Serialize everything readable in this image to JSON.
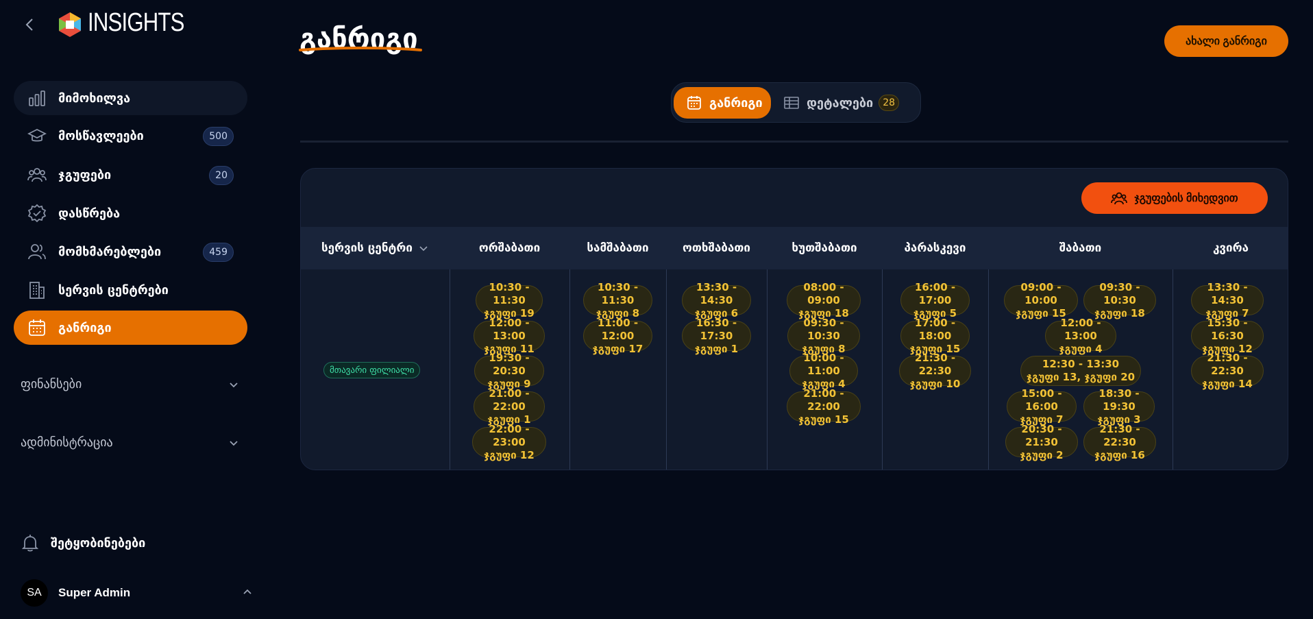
{
  "sidebar": {
    "brand": "INSIGHTS",
    "items": [
      {
        "label": "მიმოხილვა",
        "icon": "bar-chart-icon",
        "badge": ""
      },
      {
        "label": "მოსწავლეები",
        "icon": "graduation-cap-icon",
        "badge": "500"
      },
      {
        "label": "ჯგუფები",
        "icon": "groups-icon",
        "badge": "20"
      },
      {
        "label": "დასწრება",
        "icon": "check-badge-icon",
        "badge": ""
      },
      {
        "label": "მომხმარებლები",
        "icon": "users-icon",
        "badge": "459"
      },
      {
        "label": "სერვის ცენტრები",
        "icon": "building-icon",
        "badge": ""
      },
      {
        "label": "განრიგი",
        "icon": "calendar-icon",
        "badge": ""
      }
    ],
    "sections": [
      {
        "label": "ფინანსები"
      },
      {
        "label": "ადმინისტრაცია"
      }
    ],
    "notifications": "შეტყობინებები",
    "user": {
      "initials": "SA",
      "name": "Super Admin"
    }
  },
  "header": {
    "title": "განრიგი",
    "new_button": "ახალი განრიგი"
  },
  "tabs": {
    "schedule": "განრიგი",
    "details": "დეტალები",
    "details_count": "28"
  },
  "colors": {
    "accent": "#e67000",
    "background": "#050b19",
    "card": "#111a2c",
    "pill_text": "#f2c236",
    "branch_text": "#3fe0a8"
  },
  "schedule": {
    "group_button": "ჯგუფების მიხედვით",
    "center_header": "სერვის ცენტრი",
    "days": [
      "ორშაბათი",
      "სამშაბათი",
      "ოთხშაბათი",
      "ხუთშაბათი",
      "პარასკევი",
      "შაბათი",
      "კვირა"
    ],
    "branch": "მთავარი ფილიალი",
    "slots": {
      "mon": [
        {
          "time": "10:30 - 11:30",
          "group": "ჯგუფი 19"
        },
        {
          "time": "12:00 - 13:00",
          "group": "ჯგუფი 11"
        },
        {
          "time": "19:30 - 20:30",
          "group": "ჯგუფი 9"
        },
        {
          "time": "21:00 - 22:00",
          "group": "ჯგუფი 1"
        },
        {
          "time": "22:00 - 23:00",
          "group": "ჯგუფი 12"
        }
      ],
      "tue": [
        {
          "time": "10:30 - 11:30",
          "group": "ჯგუფი 8"
        },
        {
          "time": "11:00 - 12:00",
          "group": "ჯგუფი 17"
        }
      ],
      "wed": [
        {
          "time": "13:30 - 14:30",
          "group": "ჯგუფი 6"
        },
        {
          "time": "16:30 - 17:30",
          "group": "ჯგუფი 1"
        }
      ],
      "thu": [
        {
          "time": "08:00 - 09:00",
          "group": "ჯგუფი 18"
        },
        {
          "time": "09:30 - 10:30",
          "group": "ჯგუფი 8"
        },
        {
          "time": "10:00 - 11:00",
          "group": "ჯგუფი 4"
        },
        {
          "time": "21:00 - 22:00",
          "group": "ჯგუფი 15"
        }
      ],
      "fri": [
        {
          "time": "16:00 - 17:00",
          "group": "ჯგუფი 5"
        },
        {
          "time": "17:00 - 18:00",
          "group": "ჯგუფი 15"
        },
        {
          "time": "21:30 - 22:30",
          "group": "ჯგუფი 10"
        }
      ],
      "sat": [
        {
          "time": "09:00 - 10:00",
          "group": "ჯგუფი 15"
        },
        {
          "time": "09:30 - 10:30",
          "group": "ჯგუფი 18"
        },
        {
          "time": "12:00 - 13:00",
          "group": "ჯგუფი 4"
        },
        {
          "time": "12:30 - 13:30",
          "group": "ჯგუფი 13, ჯგუფი 20"
        },
        {
          "time": "15:00 - 16:00",
          "group": "ჯგუფი 7"
        },
        {
          "time": "18:30 - 19:30",
          "group": "ჯგუფი 3"
        },
        {
          "time": "20:30 - 21:30",
          "group": "ჯგუფი 2"
        },
        {
          "time": "21:30 - 22:30",
          "group": "ჯგუფი 16"
        }
      ],
      "sun": [
        {
          "time": "13:30 - 14:30",
          "group": "ჯგუფი 7"
        },
        {
          "time": "15:30 - 16:30",
          "group": "ჯგუფი 12"
        },
        {
          "time": "21:30 - 22:30",
          "group": "ჯგუფი 14"
        }
      ]
    }
  }
}
